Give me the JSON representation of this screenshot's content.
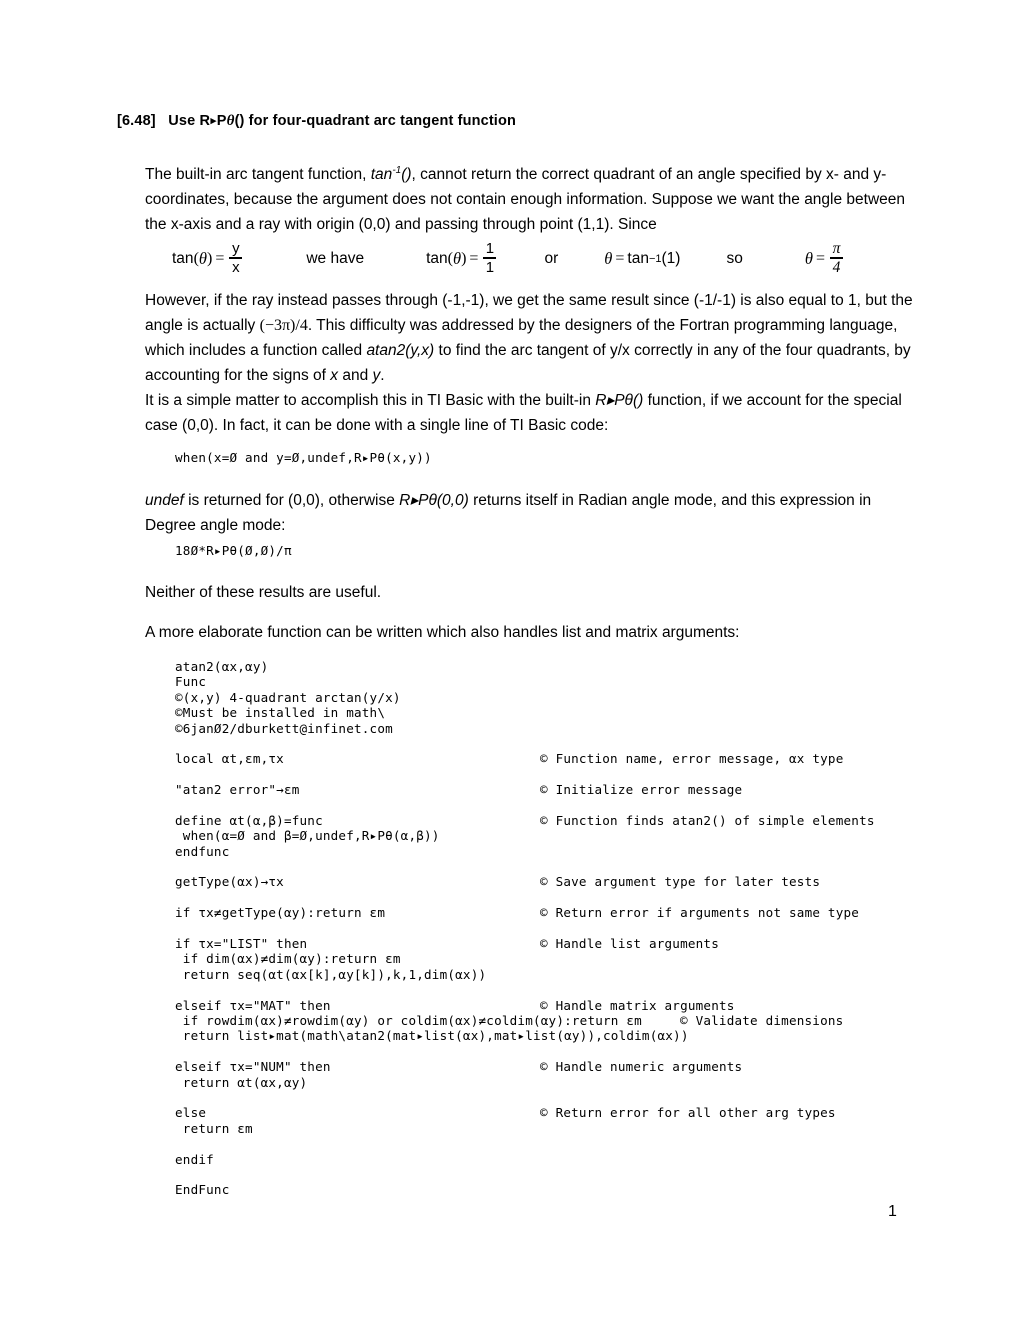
{
  "document": {
    "title_prefix": "[6.48]",
    "title_text_before": "Use R",
    "title_arrow": "▸",
    "title_text_p": "P",
    "title_theta": "θ",
    "title_text_after": "() for four-quadrant arc tangent function",
    "page_number": "1"
  },
  "paragraphs": {
    "p1_a": "The built-in arc tangent function, ",
    "p1_italic": "tan",
    "p1_sup": "-1",
    "p1_italic2": "()",
    "p1_b": ", cannot return the correct quadrant of an angle specified by x- and y-coordinates, because the argument does not contain enough information. Suppose we want the angle between the x-axis and a ray with origin (0,0) and passing through point (1,1). Since",
    "p2_a": "However, if the ray instead passes through (-1,-1), we get the same result since (-1/-1) is also equal to 1, but the angle is actually",
    "p2_math": "(−3π)/4",
    "p2_b": ". This difficulty was addressed by the designers of the Fortran programming language, which includes a function called ",
    "p2_italic": "atan2(y,x)",
    "p2_c": " to find the arc tangent of y/x correctly in any of the four quadrants, by accounting for the signs of ",
    "p2_x": "x",
    "p2_and": " and ",
    "p2_y": "y",
    "p2_end": ".",
    "p3_a": "It is a simple matter to accomplish this in TI Basic with the built-in ",
    "p3_italic": "R▸Pθ()",
    "p3_b": " function, if we account for the special case (0,0). In fact, it can be done with a single line of TI Basic code:",
    "p4_italic": "undef",
    "p4_a": " is returned for (0,0), otherwise ",
    "p4_italic2": "R▸Pθ(0,0)",
    "p4_b": " returns itself in Radian angle mode, and this expression in Degree angle mode:",
    "p5": "Neither of these results are useful.",
    "p6": "A more elaborate function can be written which also handles list and matrix arguments:"
  },
  "equation_row": {
    "lhs_fn": "tan",
    "lhs_open": "(",
    "lhs_theta": "θ",
    "lhs_close": ")",
    "eq1": "=",
    "frac1_num": "y",
    "frac1_den": "x",
    "connector1": "we have",
    "mid_fn": "tan",
    "mid_theta": "θ",
    "eq2": "=",
    "frac2_num": "1",
    "frac2_den": "1",
    "connector2": "or",
    "theta3": "θ",
    "eq3": "=",
    "atan_fn": "tan",
    "atan_exp": "−1",
    "atan_arg": "(1)",
    "connector3": "so",
    "theta4": "θ",
    "eq4": "=",
    "frac3_num": "π",
    "frac3_den": "4"
  },
  "code_snippets": {
    "one_liner": "when(x=Ø and y=Ø,undef,R▸Pθ(x,y))",
    "degree_expr": "18Ø*R▸Pθ(Ø,Ø)/π"
  },
  "listing": {
    "lines": [
      {
        "code": "atan2(αx,αy)",
        "comment": ""
      },
      {
        "code": "Func",
        "comment": ""
      },
      {
        "code": "©(x,y) 4-quadrant arctan(y/x)",
        "comment": ""
      },
      {
        "code": "©Must be installed in math\\",
        "comment": ""
      },
      {
        "code": "©6janØ2/dburkett@infinet.com",
        "comment": ""
      },
      {
        "code": "",
        "comment": ""
      },
      {
        "code": "local αt,εm,τx",
        "comment": "© Function name, error message, αx type"
      },
      {
        "code": "",
        "comment": ""
      },
      {
        "code": "\"atan2 error\"→εm",
        "comment": "© Initialize error message"
      },
      {
        "code": "",
        "comment": ""
      },
      {
        "code": "define αt(α,β)=func",
        "comment": "© Function finds atan2() of simple elements"
      },
      {
        "code": " when(α=Ø and β=Ø,undef,R▸Pθ(α,β))",
        "comment": ""
      },
      {
        "code": "endfunc",
        "comment": ""
      },
      {
        "code": "",
        "comment": ""
      },
      {
        "code": "getType(αx)→τx",
        "comment": "© Save argument type for later tests"
      },
      {
        "code": "",
        "comment": ""
      },
      {
        "code": "if τx≠getType(αy):return εm",
        "comment": "© Return error if arguments not same type"
      },
      {
        "code": "",
        "comment": ""
      },
      {
        "code": "if τx=\"LIST\" then",
        "comment": "© Handle list arguments"
      },
      {
        "code": " if dim(αx)≠dim(αy):return εm",
        "comment": ""
      },
      {
        "code": " return seq(αt(αx[k],αy[k]),k,1,dim(αx))",
        "comment": ""
      },
      {
        "code": "",
        "comment": ""
      },
      {
        "code": "elseif τx=\"MAT\" then",
        "comment": "© Handle matrix arguments"
      },
      {
        "code": " if rowdim(αx)≠rowdim(αy) or coldim(αx)≠coldim(αy):return εm",
        "comment": "© Validate dimensions",
        "comment_far": true
      },
      {
        "code": " return list▸mat(math\\atan2(mat▸list(αx),mat▸list(αy)),coldim(αx))",
        "comment": ""
      },
      {
        "code": "",
        "comment": ""
      },
      {
        "code": "elseif τx=\"NUM\" then",
        "comment": "© Handle numeric arguments"
      },
      {
        "code": " return αt(αx,αy)",
        "comment": ""
      },
      {
        "code": "",
        "comment": ""
      },
      {
        "code": "else",
        "comment": "© Return error for all other arg types"
      },
      {
        "code": " return εm",
        "comment": ""
      },
      {
        "code": "",
        "comment": ""
      },
      {
        "code": "endif",
        "comment": ""
      },
      {
        "code": "",
        "comment": ""
      },
      {
        "code": "EndFunc",
        "comment": ""
      }
    ]
  }
}
